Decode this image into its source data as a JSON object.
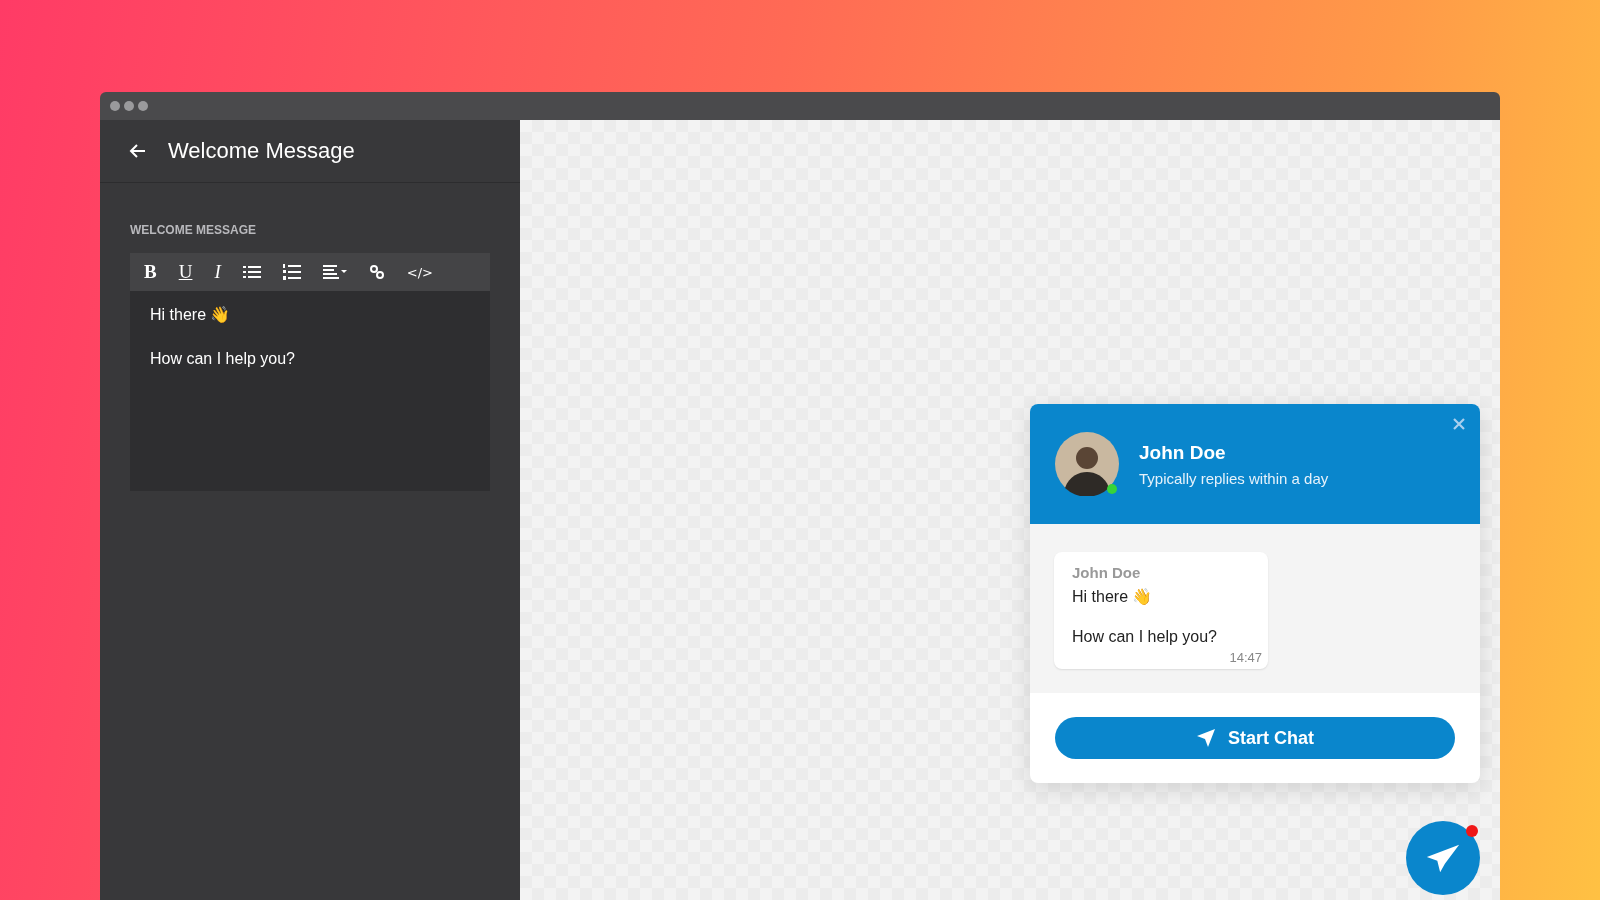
{
  "editor": {
    "title": "Welcome Message",
    "field_label": "WELCOME MESSAGE",
    "toolbar": [
      {
        "kind": "bold",
        "label": "B"
      },
      {
        "kind": "underline",
        "label": "U"
      },
      {
        "kind": "italic",
        "label": "I"
      },
      {
        "kind": "bullet_list"
      },
      {
        "kind": "numbered_list"
      },
      {
        "kind": "align"
      },
      {
        "kind": "link"
      },
      {
        "kind": "code",
        "label": "</>"
      }
    ],
    "paragraphs": [
      "Hi there 👋",
      "How can I help you?"
    ]
  },
  "widget": {
    "agent_name": "John Doe",
    "agent_status": "Typically replies within a day",
    "online": true,
    "message": {
      "sender": "John Doe",
      "paragraphs": [
        "Hi there 👋",
        "How can I help you?"
      ],
      "time": "14:47"
    },
    "start_button": "Start Chat"
  },
  "launcher": {
    "unread": true
  }
}
